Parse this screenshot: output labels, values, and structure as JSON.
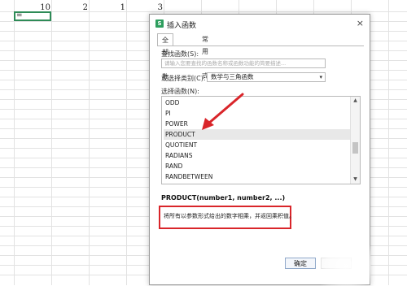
{
  "sheet": {
    "row1_values": [
      "10",
      "2",
      "1",
      "3"
    ],
    "active_cell_text": "="
  },
  "dialog": {
    "title": "插入函数",
    "app_icon_glyph": "S",
    "close_glyph": "×",
    "tabs": [
      {
        "label": "全部函数",
        "active": true
      },
      {
        "label": "常用公式",
        "active": false
      }
    ],
    "search_label": "查找函数(S):",
    "search_placeholder": "请输入您要查找的函数名称或函数功能的简要描述...",
    "category_label": "或选择类别(C):",
    "category_value": "数学与三角函数",
    "list_label": "选择函数(N):",
    "functions": [
      "ODD",
      "PI",
      "POWER",
      "PRODUCT",
      "QUOTIENT",
      "RADIANS",
      "RAND",
      "RANDBETWEEN"
    ],
    "selected_function": "PRODUCT",
    "signature": "PRODUCT(number1, number2, ...)",
    "description": "将所有以参数形式给出的数字相乘，并返回乘积值。",
    "ok_label": "确定",
    "cancel_label": ""
  },
  "annotations": {
    "highlight_color": "#d9252a"
  }
}
